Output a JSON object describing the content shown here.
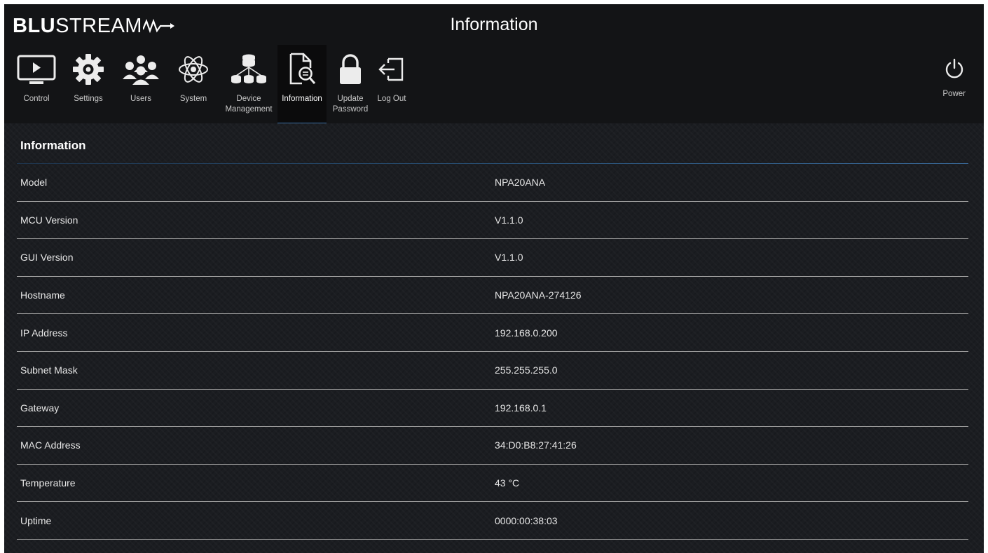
{
  "brand": {
    "bold": "BLU",
    "light": "STREAM"
  },
  "header": {
    "title": "Information"
  },
  "nav": {
    "items": [
      {
        "label": "Control",
        "icon": "tv-play-icon"
      },
      {
        "label": "Settings",
        "icon": "gear-icon"
      },
      {
        "label": "Users",
        "icon": "users-icon"
      },
      {
        "label": "System",
        "icon": "atom-icon"
      },
      {
        "label": "Device Management",
        "icon": "device-tree-icon"
      },
      {
        "label": "Information",
        "icon": "document-search-icon",
        "active": true
      },
      {
        "label": "Update Password",
        "icon": "lock-icon"
      },
      {
        "label": "Log Out",
        "icon": "logout-icon"
      }
    ],
    "power_label": "Power"
  },
  "section": {
    "title": "Information",
    "rows": [
      {
        "label": "Model",
        "value": "NPA20ANA"
      },
      {
        "label": "MCU Version",
        "value": "V1.1.0"
      },
      {
        "label": "GUI Version",
        "value": "V1.1.0"
      },
      {
        "label": "Hostname",
        "value": "NPA20ANA-274126"
      },
      {
        "label": "IP Address",
        "value": "192.168.0.200"
      },
      {
        "label": "Subnet Mask",
        "value": "255.255.255.0"
      },
      {
        "label": "Gateway",
        "value": "192.168.0.1"
      },
      {
        "label": "MAC Address",
        "value": "34:D0:B8:27:41:26"
      },
      {
        "label": "Temperature",
        "value": "43 °C"
      },
      {
        "label": "Uptime",
        "value": "0000:00:38:03"
      }
    ]
  },
  "colors": {
    "accent": "#3f78b0",
    "background": "#1b1d21",
    "header": "#131416"
  }
}
